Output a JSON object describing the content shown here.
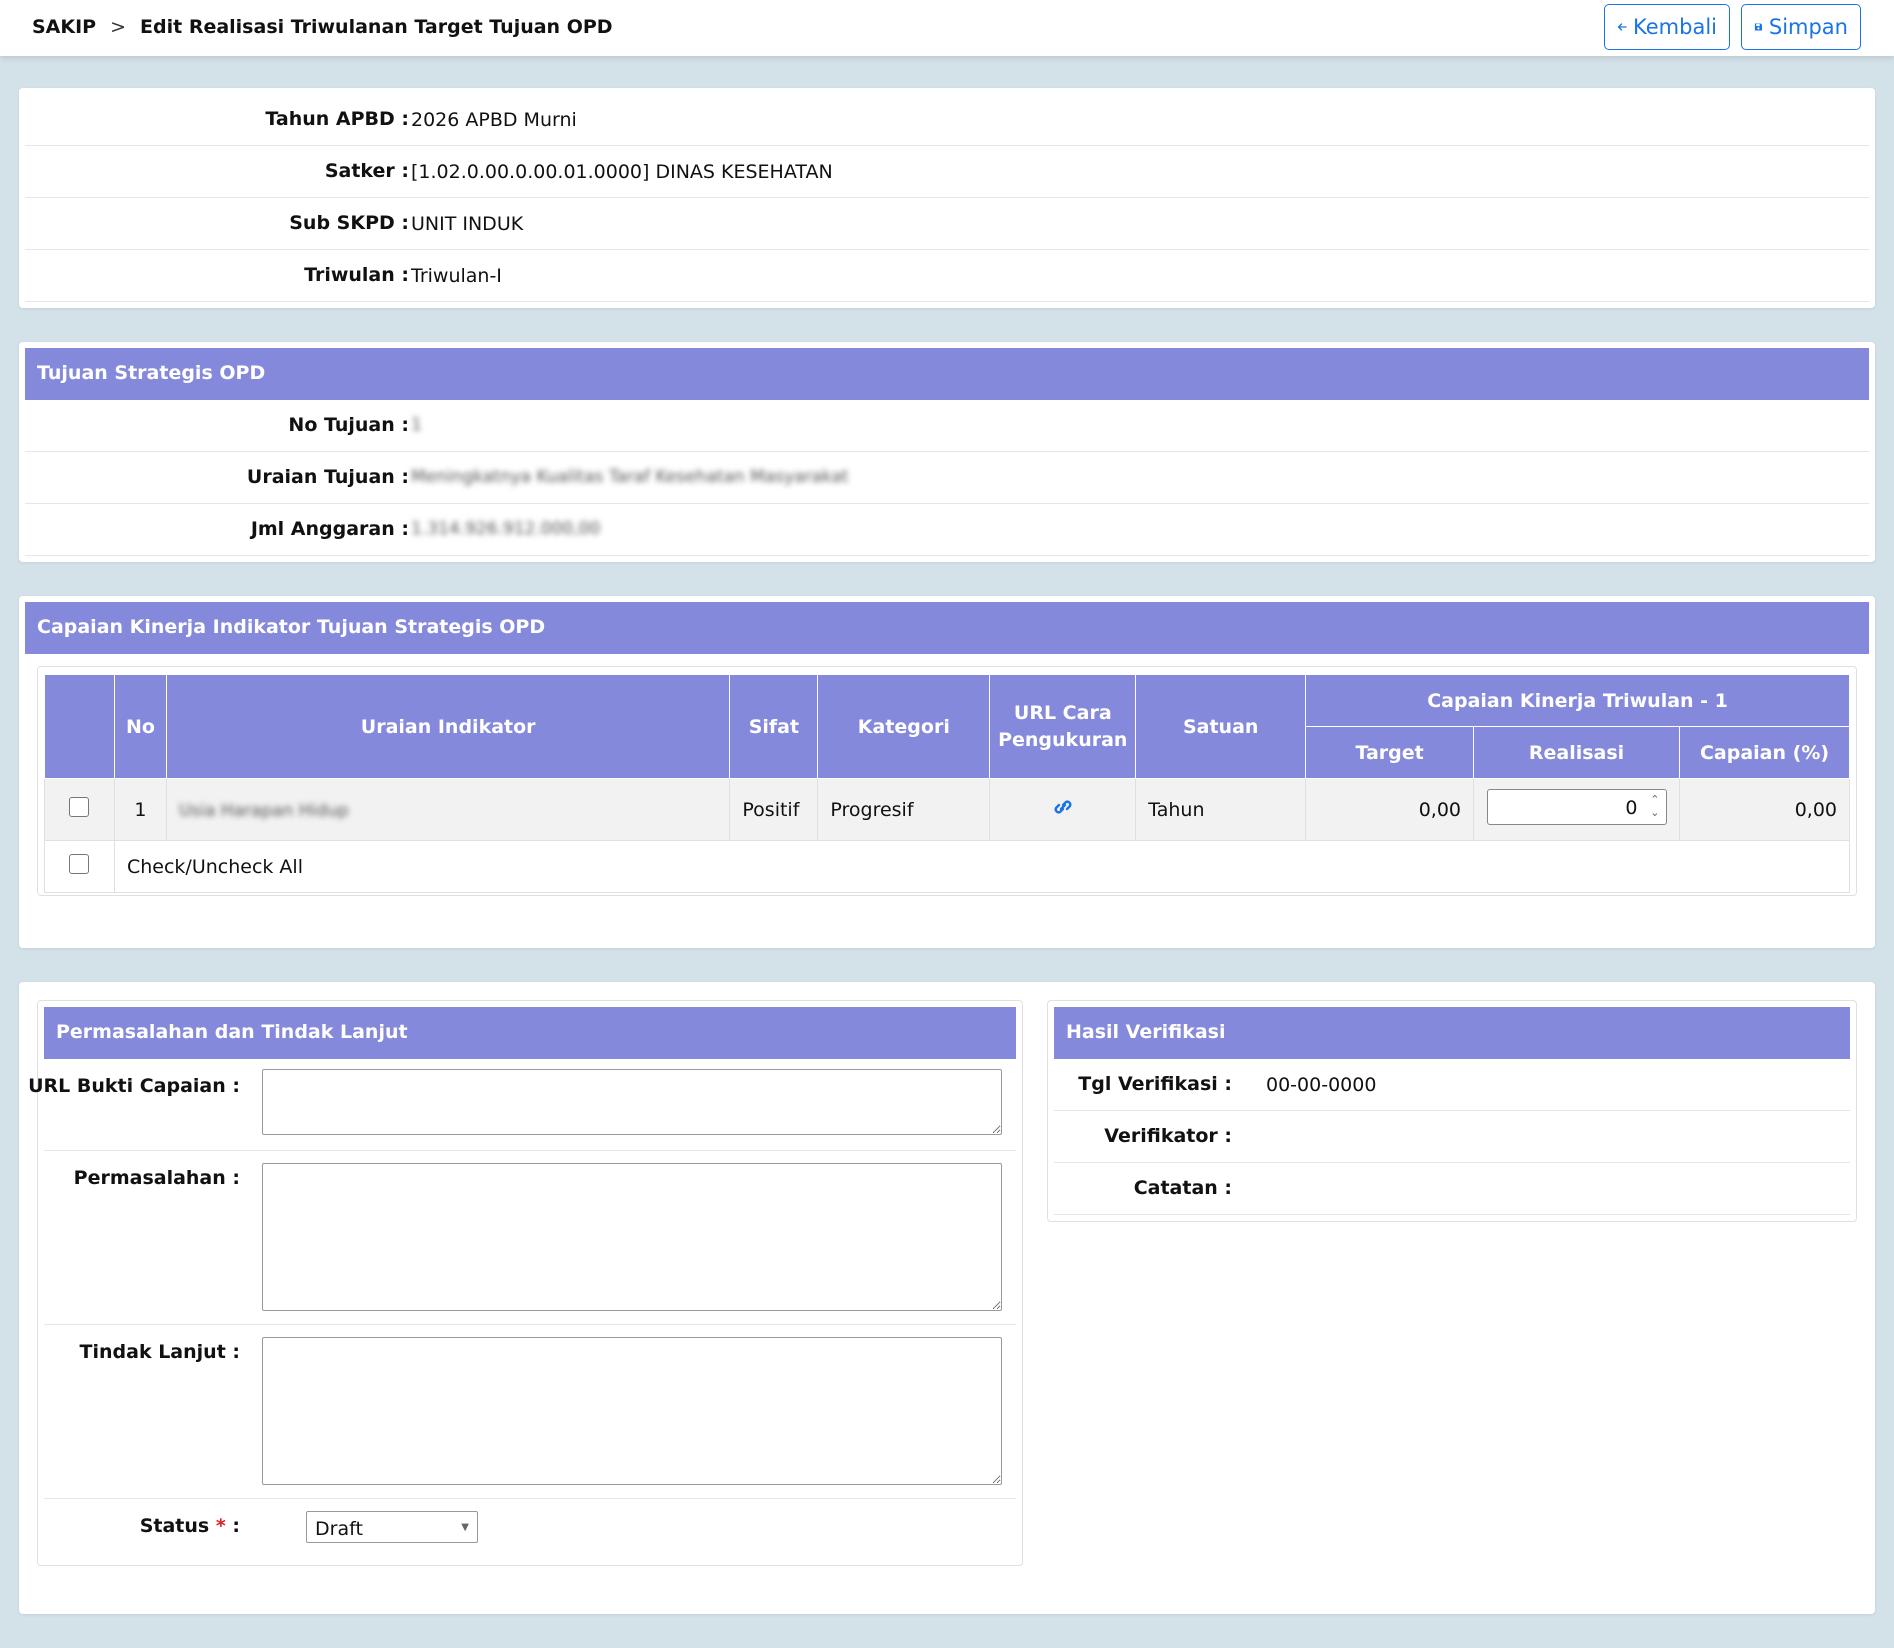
{
  "header": {
    "app": "SAKIP",
    "separator": ">",
    "page_title": "Edit Realisasi Triwulanan Target Tujuan OPD",
    "back_label": "Kembali",
    "save_label": "Simpan",
    "accent": "#1a73e8"
  },
  "info": {
    "tahun_label": "Tahun APBD :",
    "tahun_value": "2026 APBD Murni",
    "satker_label": "Satker :",
    "satker_value": "[1.02.0.00.0.00.01.0000] DINAS KESEHATAN",
    "subskpd_label": "Sub SKPD :",
    "subskpd_value": "UNIT INDUK",
    "triwulan_label": "Triwulan :",
    "triwulan_value": "Triwulan-I"
  },
  "tujuan": {
    "title": "Tujuan Strategis OPD",
    "no_label": "No Tujuan :",
    "no_value": "1",
    "uraian_label": "Uraian Tujuan :",
    "uraian_value": "Meningkatnya Kualitas Taraf Kesehatan Masyarakat",
    "anggaran_label": "Jml Anggaran :",
    "anggaran_value": "1.314.926.912.000,00"
  },
  "capaian": {
    "title": "Capaian Kinerja Indikator Tujuan Strategis OPD",
    "columns": {
      "no": "No",
      "uraian": "Uraian Indikator",
      "sifat": "Sifat",
      "kategori": "Kategori",
      "url": "URL Cara Pengukuran",
      "satuan": "Satuan",
      "group": "Capaian Kinerja Triwulan - 1",
      "target": "Target",
      "realisasi": "Realisasi",
      "persen": "Capaian (%)"
    },
    "rows": [
      {
        "no": "1",
        "uraian": "Usia Harapan Hidup",
        "sifat": "Positif",
        "kategori": "Progresif",
        "url_icon": "link-icon",
        "satuan": "Tahun",
        "target": "0,00",
        "realisasi": "0",
        "persen": "0,00"
      }
    ],
    "check_all_label": "Check/Uncheck All"
  },
  "permasalahan": {
    "title": "Permasalahan dan Tindak Lanjut",
    "url_label": "URL Bukti Capaian :",
    "masalah_label": "Permasalahan :",
    "tindak_label": "Tindak Lanjut :",
    "status_label": "Status",
    "status_required": "*",
    "status_colon": ":",
    "status_value": "Draft"
  },
  "verifikasi": {
    "title": "Hasil Verifikasi",
    "tgl_label": "Tgl Verifikasi :",
    "tgl_value": "00-00-0000",
    "verifikator_label": "Verifikator :",
    "catatan_label": "Catatan :"
  },
  "colors": {
    "section_header": "#8589db",
    "page_bg": "#d3e2e9"
  }
}
